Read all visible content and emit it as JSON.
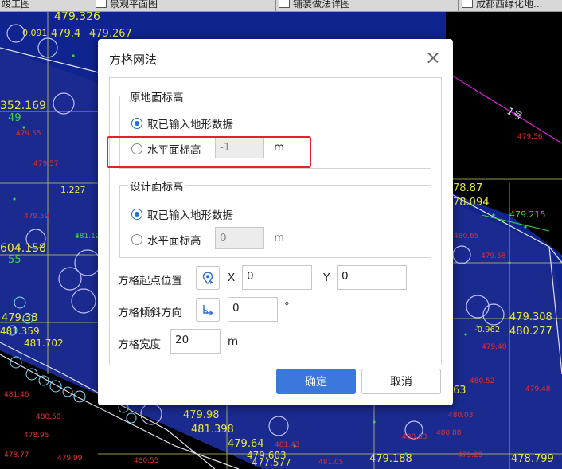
{
  "tabs": [
    {
      "label": "竣工图"
    },
    {
      "label": "景观平面图"
    },
    {
      "label": "铺装做法详图"
    },
    {
      "label": "成都西绿化地..."
    }
  ],
  "cad": {
    "labels": [
      {
        "text": "479.326",
        "color": "#e8e83a"
      },
      {
        "text": "479.267",
        "color": "#e8e83a"
      },
      {
        "text": "479.4",
        "color": "#e8e83a"
      },
      {
        "text": "0.091",
        "color": "#e8e83a"
      },
      {
        "text": "352.169",
        "color": "#e8e83a"
      },
      {
        "text": "49",
        "color": "#3ad63a"
      },
      {
        "text": "479.55",
        "color": "#e03030"
      },
      {
        "text": "479.57",
        "color": "#e03030"
      },
      {
        "text": "479.59",
        "color": "#e03030"
      },
      {
        "text": "1.227",
        "color": "#e8e83a"
      },
      {
        "text": "604.158",
        "color": "#e8e83a"
      },
      {
        "text": "55",
        "color": "#3ad63a"
      },
      {
        "text": "479.38",
        "color": "#e8e83a"
      },
      {
        "text": "481.359",
        "color": "#e8e83a"
      },
      {
        "text": "481.702",
        "color": "#e8e83a"
      },
      {
        "text": "78.87",
        "color": "#e8e83a"
      },
      {
        "text": "78.094",
        "color": "#e8e83a"
      },
      {
        "text": "479.215",
        "color": "#3ad63a"
      },
      {
        "text": "479.308",
        "color": "#e8e83a"
      },
      {
        "text": "480.277",
        "color": "#e8e83a"
      },
      {
        "text": "-0.962",
        "color": "#e8e83a"
      },
      {
        "text": "479.98",
        "color": "#e8e83a"
      },
      {
        "text": "481.398",
        "color": "#e8e83a"
      },
      {
        "text": "479.64",
        "color": "#e8e83a"
      },
      {
        "text": "479.603",
        "color": "#e8e83a"
      },
      {
        "text": "477.577",
        "color": "#e8e83a"
      },
      {
        "text": "479.188",
        "color": "#e8e83a"
      },
      {
        "text": "478.799",
        "color": "#e8e83a"
      },
      {
        "text": "63",
        "color": "#e8e83a"
      },
      {
        "text": "479.56",
        "color": "#e03030"
      },
      {
        "text": "480.52",
        "color": "#e03030"
      },
      {
        "text": "480.50",
        "color": "#e03030"
      },
      {
        "text": "478.95",
        "color": "#e03030"
      },
      {
        "text": "481.05",
        "color": "#e03030"
      },
      {
        "text": "479.29",
        "color": "#e03030"
      },
      {
        "text": "478.77",
        "color": "#e03030"
      },
      {
        "text": "479.48",
        "color": "#e03030"
      },
      {
        "text": "481.46",
        "color": "#e03030"
      },
      {
        "text": "479.99",
        "color": "#e03030"
      },
      {
        "text": "480.55",
        "color": "#e03030"
      },
      {
        "text": "480.83",
        "color": "#e03030"
      },
      {
        "text": "480.03",
        "color": "#e03030"
      },
      {
        "text": "480.88",
        "color": "#e03030"
      },
      {
        "text": "481.43",
        "color": "#e03030"
      },
      {
        "text": "480.65",
        "color": "#e03030"
      },
      {
        "text": "481.12",
        "color": "#3ad63a"
      },
      {
        "text": "479.58",
        "color": "#e03030"
      },
      {
        "text": "479.40",
        "color": "#e03030"
      }
    ]
  },
  "dialog": {
    "title": "方格网法",
    "original": {
      "title": "原地面标高",
      "option_terrain": "取已输入地形数据",
      "option_level": "水平面标高",
      "level_value": "-1",
      "unit": "m"
    },
    "design": {
      "title": "设计面标高",
      "option_terrain": "取已输入地形数据",
      "option_level": "水平面标高",
      "level_value": "0",
      "unit": "m"
    },
    "grid_origin": {
      "label": "方格起点位置",
      "x_label": "X",
      "x_value": "0",
      "y_label": "Y",
      "y_value": "0"
    },
    "grid_angle": {
      "label": "方格倾斜方向",
      "value": "0",
      "unit": "°"
    },
    "grid_width": {
      "label": "方格宽度",
      "value": "20",
      "unit": "m"
    },
    "ok_label": "确定",
    "cancel_label": "取消"
  }
}
